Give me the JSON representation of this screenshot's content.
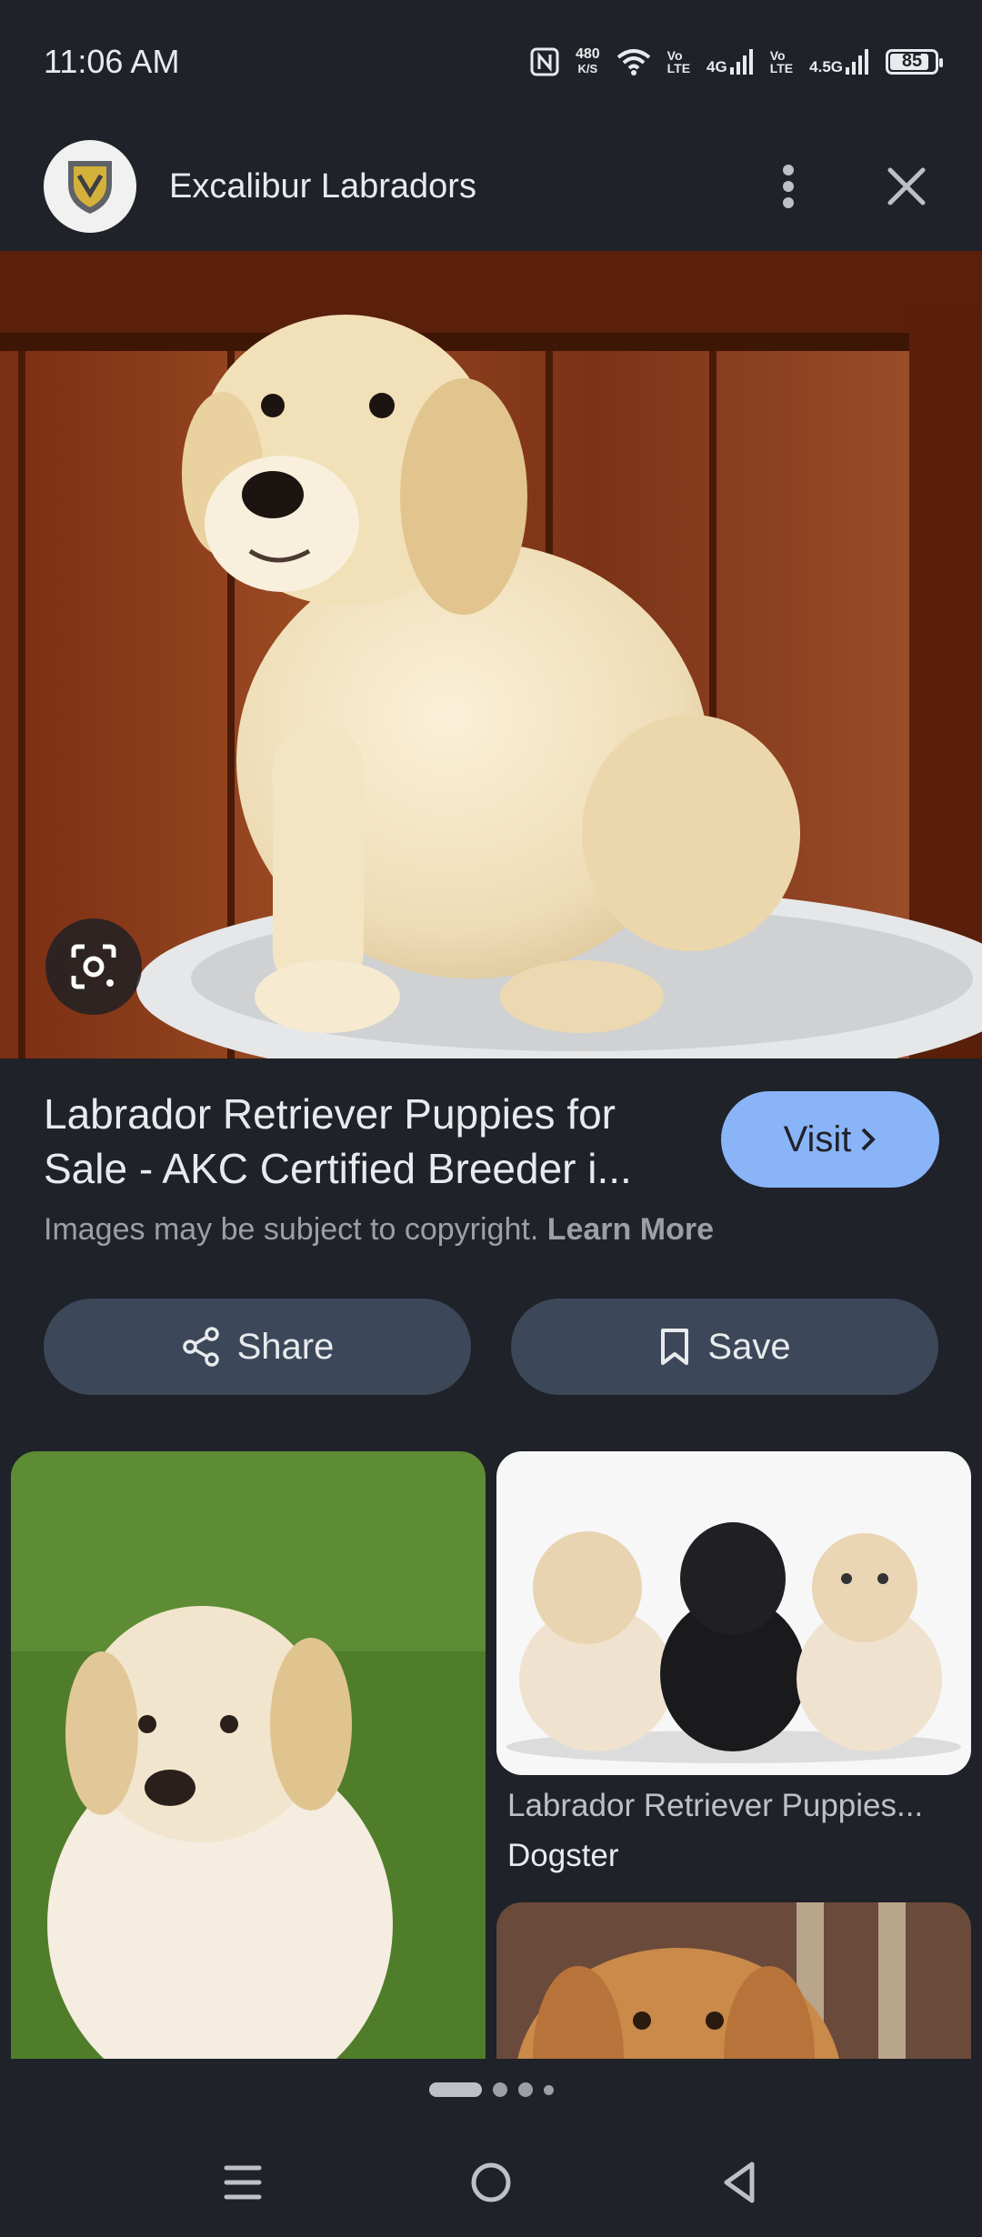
{
  "status_bar": {
    "time": "11:06 AM",
    "net_speed_value": "480",
    "net_speed_unit": "K/S",
    "sim1_volte": "Vo\nLTE",
    "sim1_type": "4G",
    "sim2_volte": "Vo\nLTE",
    "sim2_type": "4.5G",
    "battery": "85"
  },
  "header": {
    "site_name": "Excalibur Labradors"
  },
  "result": {
    "title": "Labrador Retriever Puppies for Sale - AKC Certified Breeder i...",
    "visit_label": "Visit",
    "copyright_text": "Images may be subject to copyright.",
    "learn_more": "Learn More"
  },
  "actions": {
    "share_label": "Share",
    "save_label": "Save"
  },
  "related": {
    "card2_title": "Labrador Retriever Puppies...",
    "card2_source": "Dogster"
  },
  "pager": {
    "total_dots": 4,
    "active_index": 0
  }
}
